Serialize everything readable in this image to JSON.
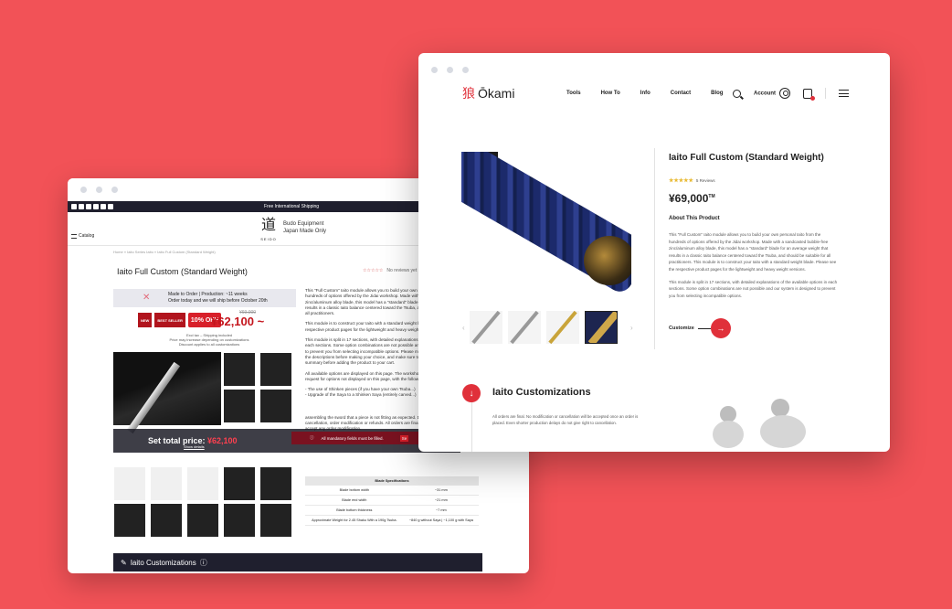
{
  "back_window": {
    "topbar_shipping": "Free International Shipping",
    "brand_lines": [
      "Budo Equipment",
      "Japan Made Only"
    ],
    "brand_kanji": "道",
    "brand_small": "SEIDO",
    "catalog_label": "Catalog",
    "breadcrumb": "Home » Iaito Series Iaito » Iaito Full Custom (Standard Weight)",
    "title": "Iaito Full Custom (Standard Weight)",
    "stars": "☆☆☆☆☆",
    "reviews": "No reviews yet",
    "made_line1": "Made to Order | Production: ~11 weeks",
    "made_line2": "Order today and we will ship before October 20th",
    "badge_new": "NEW",
    "badge_best": "BEST SELLER",
    "badge_off": "10% OFF",
    "old_price": "¥69,000",
    "price": "¥62,100 ~",
    "note1": "Excl tax – Shipping included",
    "note2": "Price may increase depending on customizations",
    "note3": "Discount applies to all customizations",
    "desc1": "This \"Full Custom\" Iaito module allows you to build your own personal Iaito from the hundreds of options offered by the Jidai workshop. Made with a sandcasted bubble-free zinc/aluminum alloy blade, this model has a \"standard\" blade for an average weight that results in a classic Iaito balance centered toward the Tsuba, and should be suitable for all practitioners.",
    "desc2": "This module is to construct your Iaito with a standard weight blade. Please see the respective product pages for the lightweight and heavy weight versions.",
    "desc3": "This module is split in 17 sections, with detailed explanations of the available options in each sections. Some option combinations are not possible and our system is designed to prevent you from selecting incompatible options. Please make sure you have read all the descriptions before making your choice, and make sure to review your order in the summary before adding the product to your cart.",
    "desc4": "All available options are displayed on this page. The workshop does not accept special request for options not displayed on this page, with the following exceptions:",
    "desc5": "- The use of Shinken pieces (if you have your own Tsuba...)",
    "desc6": "- Upgrade of the Saya to a Shinken Saya (entirely carved...)",
    "desc7": "assembling the sword that a piece is not fitting as expected. Delays cannot motivate cancellation, order modification or refunds. All orders are final, the workshop will not accept any order modification.",
    "set_total_label": "Set total price:",
    "set_total_value": "¥62,100",
    "show_details": "Show details",
    "warning": "All mandatory fields must be filled.",
    "warning_btn": "Se",
    "spec_header": "Blade Specifications",
    "spec_rows": [
      [
        "Blade bottom width",
        "~31 mm"
      ],
      [
        "Blade end width",
        "~21 mm"
      ],
      [
        "Blade bottom thickness",
        "~7 mm"
      ],
      [
        "Approximate Weight for 2.45 Shaku With a 190g Tsuba.",
        "~840 g without Saya | ~1,100 g with Saya"
      ]
    ],
    "customizations_label": "Iaito Customizations"
  },
  "front_window": {
    "logo_kanji": "狼",
    "logo_text": "Ōkami",
    "menu": [
      "Tools",
      "How To",
      "Info",
      "Contact",
      "Blog"
    ],
    "account_label": "Account",
    "title": "Iaito Full Custom (Standard Weight)",
    "stars": "★★★★★",
    "reviews": "5 Reviews",
    "price": "¥69,000",
    "price_sup": "TM",
    "about_heading": "About This Product",
    "about_p1_bold": "\"Full Custom\" Iaito module",
    "about_p1": "This \"Full Custom\" Iaito module allows you to build your own personal Iaito from the hundreds of options offered by the Jidai workshop. Made with a sandcasted bubble-free zinc/aluminum alloy blade, this model has a \"standard\" blade for an average weight that results in a classic Iaito balance centered toward the Tsuba, and should be suitable for all practitioners. This module is to construct your Iaito with a standard weight blade. Please see the respective product pages for the lightweight and heavy weight versions.",
    "about_p2": "This module is split in 17 sections, with detailed explanations of the available options in each sections. Some option combinations are not possible and our system is designed to prevent you from selecting incompatible options.",
    "customize_label": "Customize",
    "section_heading": "Iaito Customizations",
    "section_text": "All orders are final. No modification or cancellation will be accepted once an order is placed. Even shorter production delays do not give right to cancellation.",
    "accent": "#e0303a"
  },
  "background_color": "#f25257"
}
